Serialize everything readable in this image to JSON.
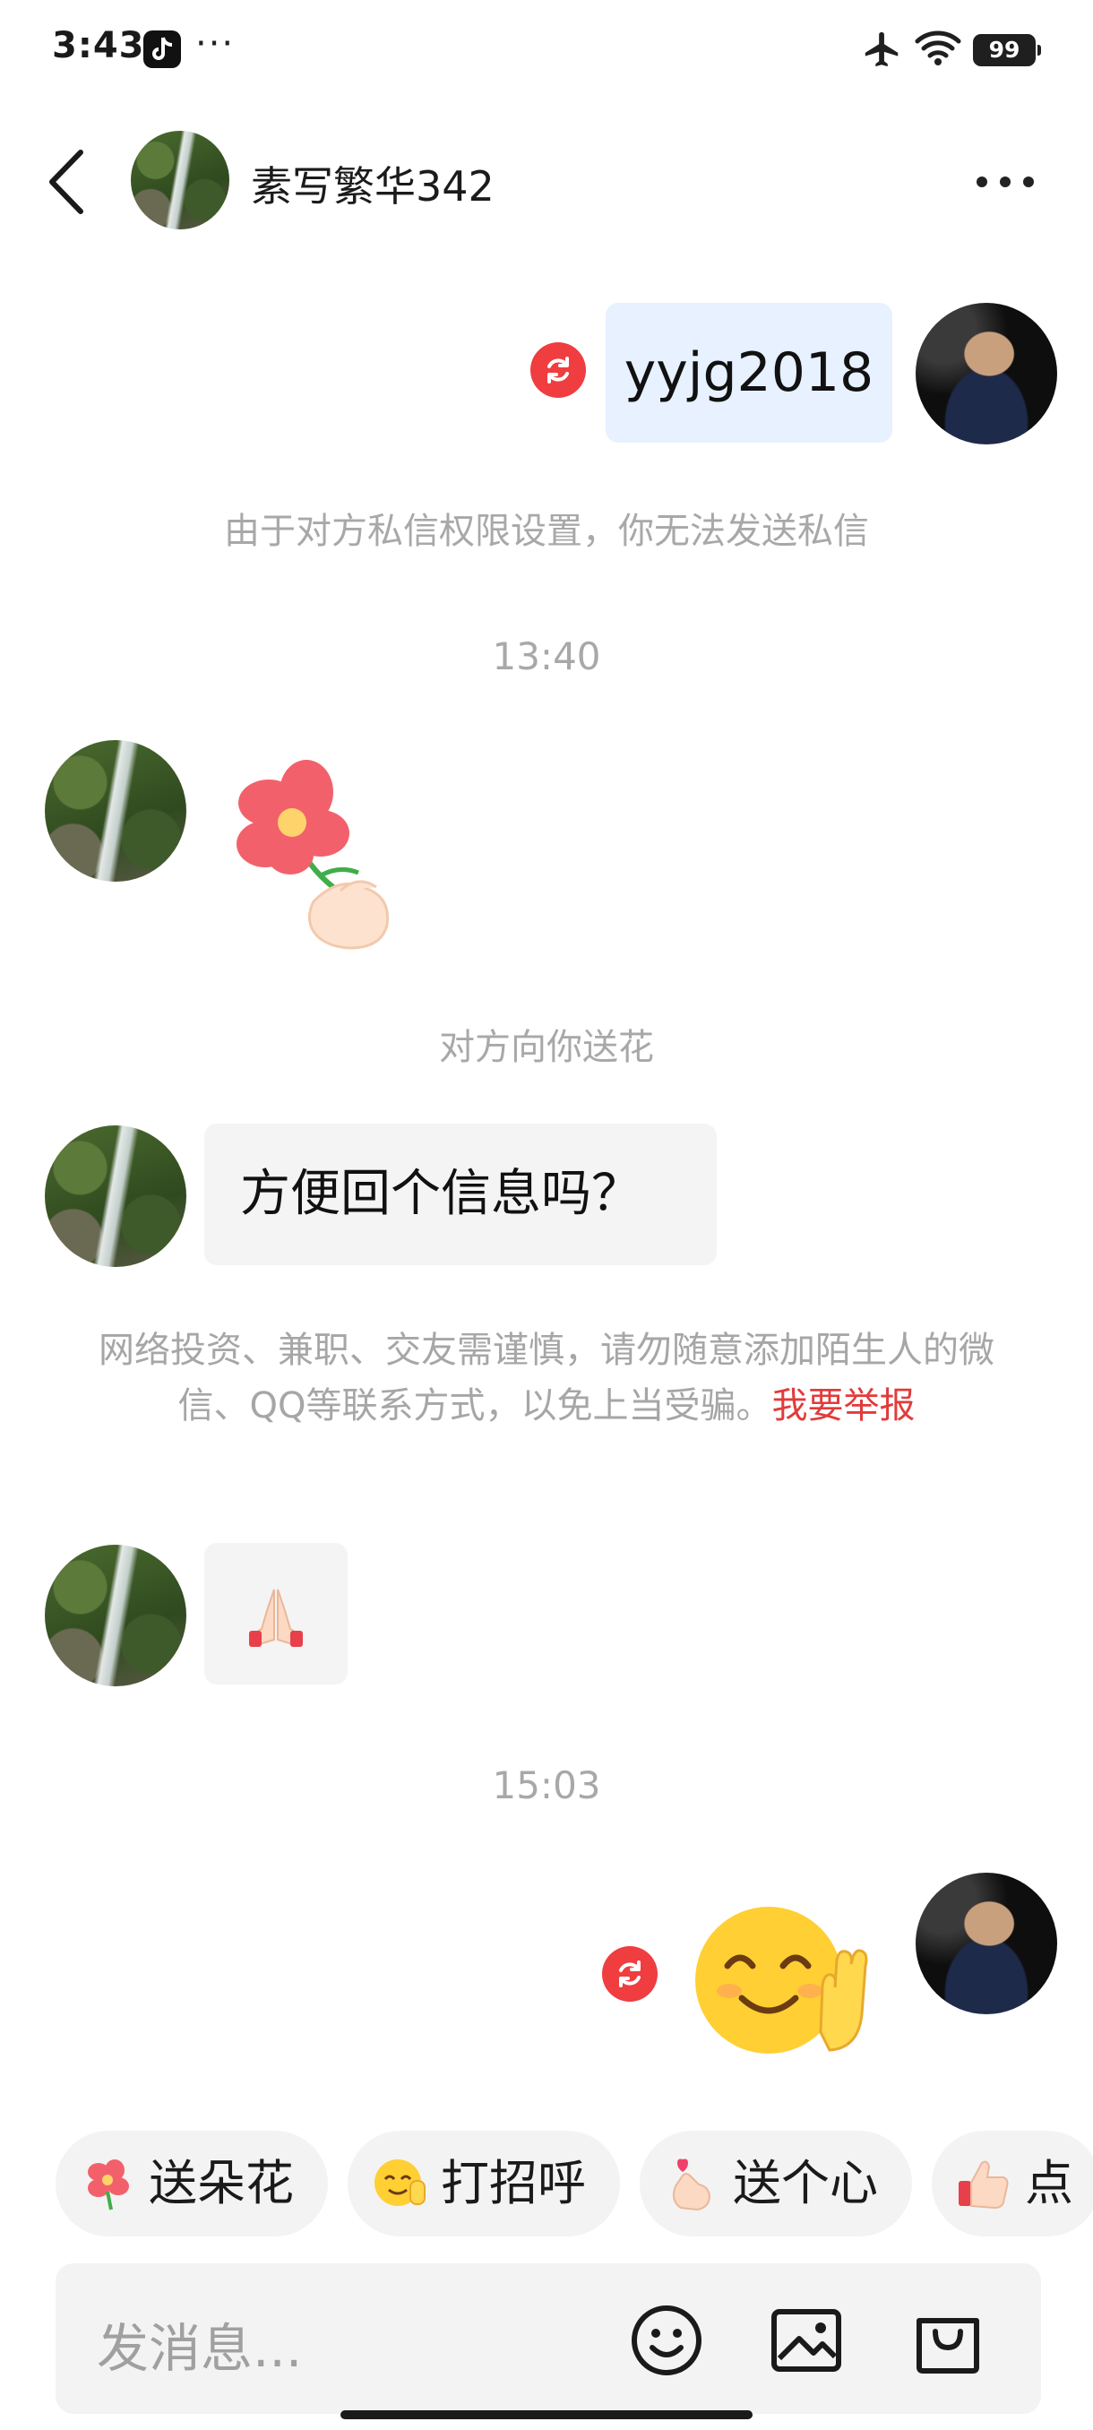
{
  "status_bar": {
    "time": "3:43",
    "extra": "···",
    "battery": "99"
  },
  "header": {
    "contact_name": "素写繁华342"
  },
  "messages": {
    "sent_text": "yyjg2018",
    "blocked_notice": "由于对方私信权限设置，你无法发送私信",
    "timestamp_1": "13:40",
    "flower_notice": "对方向你送花",
    "received_text": "方便回个信息吗？",
    "warning_text": "网络投资、兼职、交友需谨慎，请勿随意添加陌生人的微信、QQ等联系方式，以免上当受骗。",
    "report_link": "我要举报",
    "timestamp_2": "15:03"
  },
  "quick_actions": [
    {
      "label": "送朵花",
      "icon": "flower-emoji-icon"
    },
    {
      "label": "打招呼",
      "icon": "greeting-emoji-icon"
    },
    {
      "label": "送个心",
      "icon": "finger-heart-emoji-icon"
    },
    {
      "label": "点",
      "icon": "thumbs-up-emoji-icon"
    }
  ],
  "input": {
    "placeholder": "发消息..."
  },
  "colors": {
    "accent_red": "#ef3d40",
    "sent_bubble": "#e7f1ff",
    "received_bubble": "#f4f4f4",
    "muted_text": "#a8a8a8"
  }
}
